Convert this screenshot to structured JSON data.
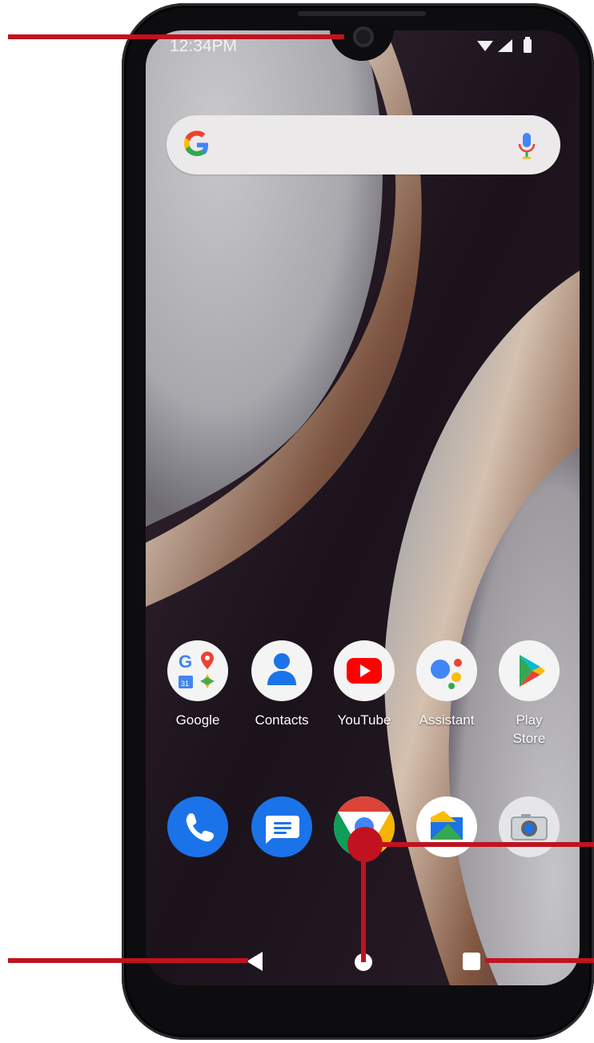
{
  "status_bar": {
    "time": "12:34PM"
  },
  "search": {
    "google_logo": "google-g-icon",
    "voice_icon": "mic-icon"
  },
  "apps_row1": [
    {
      "id": "google",
      "label": "Google"
    },
    {
      "id": "contacts",
      "label": "Contacts"
    },
    {
      "id": "youtube",
      "label": "YouTube"
    },
    {
      "id": "assistant",
      "label": "Assistant"
    },
    {
      "id": "play-store",
      "label": "Play\nStore"
    }
  ],
  "dock": [
    {
      "id": "phone",
      "icon": "phone-icon"
    },
    {
      "id": "messages",
      "icon": "messages-icon"
    },
    {
      "id": "chrome",
      "icon": "chrome-icon"
    },
    {
      "id": "files",
      "icon": "files-icon"
    },
    {
      "id": "camera",
      "icon": "camera-icon"
    }
  ],
  "nav_bar": {
    "back": "back-icon",
    "home": "home-icon",
    "recents": "recents-icon"
  },
  "colors": {
    "annotation": "#c1121f",
    "bezel": "#0d0d0f",
    "search_bg": "#ece9ea"
  }
}
